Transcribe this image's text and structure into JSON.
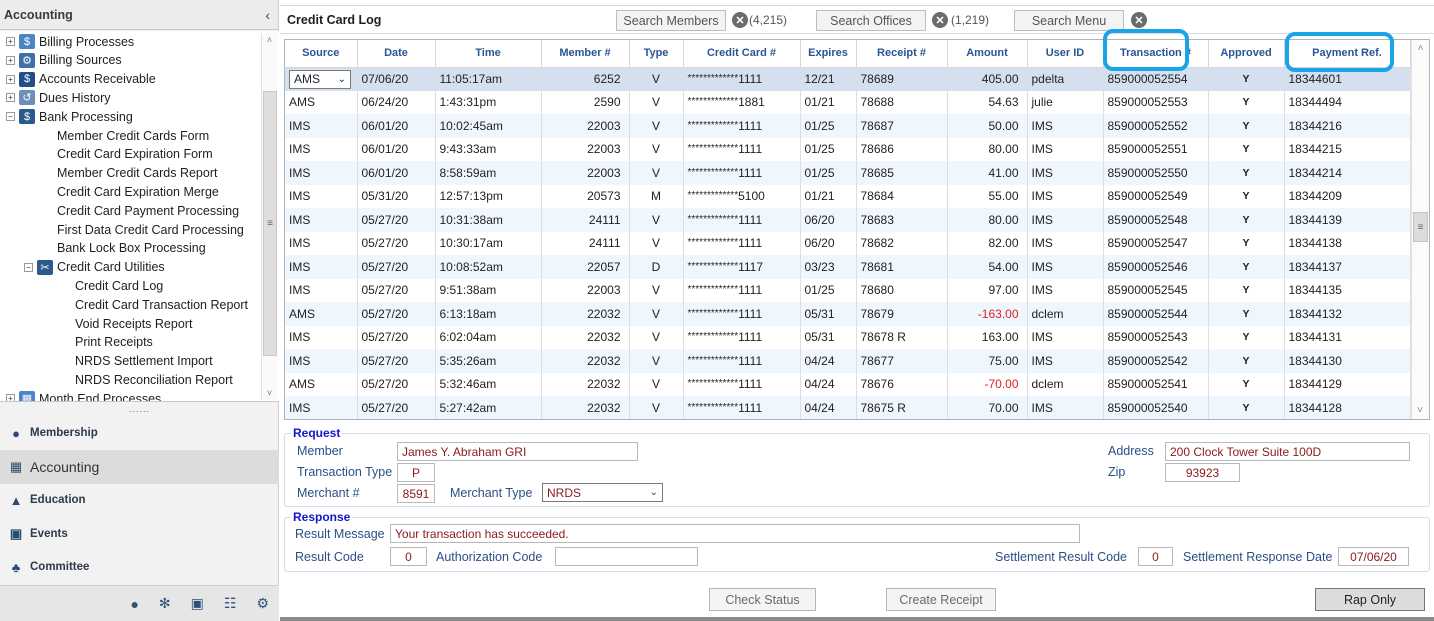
{
  "sidebar": {
    "title": "Accounting",
    "collapse_icon": "chevron-left-icon",
    "tree": [
      {
        "label": "Billing Processes",
        "level": 0,
        "toggle": "+",
        "icon": "billing-processes-icon"
      },
      {
        "label": "Billing Sources",
        "level": 0,
        "toggle": "+",
        "icon": "billing-sources-icon"
      },
      {
        "label": "Accounts Receivable",
        "level": 0,
        "toggle": "+",
        "icon": "dollar-icon"
      },
      {
        "label": "Dues History",
        "level": 0,
        "toggle": "+",
        "icon": "history-icon"
      },
      {
        "label": "Bank Processing",
        "level": 0,
        "toggle": "−",
        "icon": "bank-icon"
      },
      {
        "label": "Member Credit Cards Form",
        "level": 1
      },
      {
        "label": "Credit Card Expiration Form",
        "level": 1
      },
      {
        "label": "Member Credit Cards Report",
        "level": 1
      },
      {
        "label": "Credit Card Expiration Merge",
        "level": 1
      },
      {
        "label": "Credit Card Payment Processing",
        "level": 1
      },
      {
        "label": "First Data Credit Card Processing",
        "level": 1
      },
      {
        "label": "Bank Lock Box Processing",
        "level": 1
      },
      {
        "label": "Credit Card Utilities",
        "level": 1,
        "toggle": "−",
        "icon": "tools-icon"
      },
      {
        "label": "Credit Card Log",
        "level": 2
      },
      {
        "label": "Credit Card Transaction Report",
        "level": 2
      },
      {
        "label": "Void Receipts Report",
        "level": 2
      },
      {
        "label": "Print Receipts",
        "level": 2
      },
      {
        "label": "NRDS Settlement Import",
        "level": 2
      },
      {
        "label": "NRDS Reconciliation Report",
        "level": 2
      },
      {
        "label": "Month End Processes",
        "level": 0,
        "toggle": "+",
        "icon": "calendar-icon"
      }
    ],
    "grip": "......",
    "nav": [
      {
        "label": "Membership",
        "icon": "user-circle-icon",
        "active": false
      },
      {
        "label": "Accounting",
        "icon": "calculator-icon",
        "active": true
      },
      {
        "label": "Education",
        "icon": "graduation-cap-icon",
        "active": false
      },
      {
        "label": "Events",
        "icon": "calendar-icon",
        "active": false
      },
      {
        "label": "Committee",
        "icon": "group-icon",
        "active": false
      }
    ],
    "bottom_icons": [
      "coins-icon",
      "handshake-icon",
      "briefcase-icon",
      "contact-book-icon",
      "gear-icon"
    ]
  },
  "header": {
    "title": "Credit Card Log",
    "search_members": "Search Members",
    "members_count": "(4,215)",
    "search_offices": "Search Offices",
    "offices_count": "(1,219)",
    "search_menu": "Search Menu"
  },
  "grid": {
    "columns": [
      "Source",
      "Date",
      "Time",
      "Member #",
      "Type",
      "Credit Card #",
      "Expires",
      "Receipt #",
      "Amount",
      "User ID",
      "Transaction #",
      "Approved",
      "Payment Ref."
    ],
    "highlighted_columns": [
      "Transaction #",
      "Payment Ref."
    ],
    "selected_row": 0,
    "rows": [
      {
        "source": "AMS",
        "date": "07/06/20",
        "time": "11:05:17am",
        "member": "6252",
        "type": "V",
        "mask": "*************",
        "last4": "1111",
        "expires": "12/21",
        "receipt": "78689",
        "amount": "405.00",
        "user": "pdelta",
        "txn": "859000052554",
        "approved": "Y",
        "ref": "18344601"
      },
      {
        "source": "AMS",
        "date": "06/24/20",
        "time": "1:43:31pm",
        "member": "2590",
        "type": "V",
        "mask": "*************",
        "last4": "1881",
        "expires": "01/21",
        "receipt": "78688",
        "amount": "54.63",
        "user": "julie",
        "txn": "859000052553",
        "approved": "Y",
        "ref": "18344494"
      },
      {
        "source": "IMS",
        "date": "06/01/20",
        "time": "10:02:45am",
        "member": "22003",
        "type": "V",
        "mask": "*************",
        "last4": "1111",
        "expires": "01/25",
        "receipt": "78687",
        "amount": "50.00",
        "user": "IMS",
        "txn": "859000052552",
        "approved": "Y",
        "ref": "18344216"
      },
      {
        "source": "IMS",
        "date": "06/01/20",
        "time": "9:43:33am",
        "member": "22003",
        "type": "V",
        "mask": "*************",
        "last4": "1111",
        "expires": "01/25",
        "receipt": "78686",
        "amount": "80.00",
        "user": "IMS",
        "txn": "859000052551",
        "approved": "Y",
        "ref": "18344215"
      },
      {
        "source": "IMS",
        "date": "06/01/20",
        "time": "8:58:59am",
        "member": "22003",
        "type": "V",
        "mask": "*************",
        "last4": "1111",
        "expires": "01/25",
        "receipt": "78685",
        "amount": "41.00",
        "user": "IMS",
        "txn": "859000052550",
        "approved": "Y",
        "ref": "18344214"
      },
      {
        "source": "IMS",
        "date": "05/31/20",
        "time": "12:57:13pm",
        "member": "20573",
        "type": "M",
        "mask": "*************",
        "last4": "5100",
        "expires": "01/21",
        "receipt": "78684",
        "amount": "55.00",
        "user": "IMS",
        "txn": "859000052549",
        "approved": "Y",
        "ref": "18344209"
      },
      {
        "source": "IMS",
        "date": "05/27/20",
        "time": "10:31:38am",
        "member": "24111",
        "type": "V",
        "mask": "*************",
        "last4": "1111",
        "expires": "06/20",
        "receipt": "78683",
        "amount": "80.00",
        "user": "IMS",
        "txn": "859000052548",
        "approved": "Y",
        "ref": "18344139"
      },
      {
        "source": "IMS",
        "date": "05/27/20",
        "time": "10:30:17am",
        "member": "24111",
        "type": "V",
        "mask": "*************",
        "last4": "1111",
        "expires": "06/20",
        "receipt": "78682",
        "amount": "82.00",
        "user": "IMS",
        "txn": "859000052547",
        "approved": "Y",
        "ref": "18344138"
      },
      {
        "source": "IMS",
        "date": "05/27/20",
        "time": "10:08:52am",
        "member": "22057",
        "type": "D",
        "mask": "*************",
        "last4": "1117",
        "expires": "03/23",
        "receipt": "78681",
        "amount": "54.00",
        "user": "IMS",
        "txn": "859000052546",
        "approved": "Y",
        "ref": "18344137"
      },
      {
        "source": "IMS",
        "date": "05/27/20",
        "time": "9:51:38am",
        "member": "22003",
        "type": "V",
        "mask": "*************",
        "last4": "1111",
        "expires": "01/25",
        "receipt": "78680",
        "amount": "97.00",
        "user": "IMS",
        "txn": "859000052545",
        "approved": "Y",
        "ref": "18344135"
      },
      {
        "source": "AMS",
        "date": "05/27/20",
        "time": "6:13:18am",
        "member": "22032",
        "type": "V",
        "mask": "*************",
        "last4": "1111",
        "expires": "05/31",
        "receipt": "78679",
        "amount": "-163.00",
        "user": "dclem",
        "txn": "859000052544",
        "approved": "Y",
        "ref": "18344132"
      },
      {
        "source": "IMS",
        "date": "05/27/20",
        "time": "6:02:04am",
        "member": "22032",
        "type": "V",
        "mask": "*************",
        "last4": "1111",
        "expires": "05/31",
        "receipt": "78678 R",
        "amount": "163.00",
        "user": "IMS",
        "txn": "859000052543",
        "approved": "Y",
        "ref": "18344131"
      },
      {
        "source": "IMS",
        "date": "05/27/20",
        "time": "5:35:26am",
        "member": "22032",
        "type": "V",
        "mask": "*************",
        "last4": "1111",
        "expires": "04/24",
        "receipt": "78677",
        "amount": "75.00",
        "user": "IMS",
        "txn": "859000052542",
        "approved": "Y",
        "ref": "18344130"
      },
      {
        "source": "AMS",
        "date": "05/27/20",
        "time": "5:32:46am",
        "member": "22032",
        "type": "V",
        "mask": "*************",
        "last4": "1111",
        "expires": "04/24",
        "receipt": "78676",
        "amount": "-70.00",
        "user": "dclem",
        "txn": "859000052541",
        "approved": "Y",
        "ref": "18344129"
      },
      {
        "source": "IMS",
        "date": "05/27/20",
        "time": "5:27:42am",
        "member": "22032",
        "type": "V",
        "mask": "*************",
        "last4": "1111",
        "expires": "04/24",
        "receipt": "78675 R",
        "amount": "70.00",
        "user": "IMS",
        "txn": "859000052540",
        "approved": "Y",
        "ref": "18344128"
      }
    ]
  },
  "request": {
    "legend": "Request",
    "member_label": "Member",
    "member_value": "James Y. Abraham GRI",
    "txn_type_label": "Transaction Type",
    "txn_type_value": "P",
    "merchant_label": "Merchant #",
    "merchant_value": "8591",
    "merchant_type_label": "Merchant Type",
    "merchant_type_value": "NRDS",
    "address_label": "Address",
    "address_value": "200 Clock Tower Suite 100D",
    "zip_label": "Zip",
    "zip_value": "93923"
  },
  "response": {
    "legend": "Response",
    "result_message_label": "Result Message",
    "result_message_value": "Your transaction has succeeded.",
    "result_code_label": "Result Code",
    "result_code_value": "0",
    "auth_code_label": "Authorization Code",
    "auth_code_value": "",
    "settle_code_label": "Settlement Result Code",
    "settle_code_value": "0",
    "settle_date_label": "Settlement Response Date",
    "settle_date_value": "07/06/20"
  },
  "actions": {
    "check_status": "Check Status",
    "create_receipt": "Create Receipt",
    "rap_only": "Rap Only"
  },
  "colors": {
    "accent_header": "#2a5594",
    "highlight_ring": "#1aa3e8",
    "negative_amount": "#e02020",
    "field_value": "#8b1a1a",
    "group_legend": "#1414d0",
    "selected_row": "#d4e0ef",
    "alt_row": "#f0f6fd"
  }
}
